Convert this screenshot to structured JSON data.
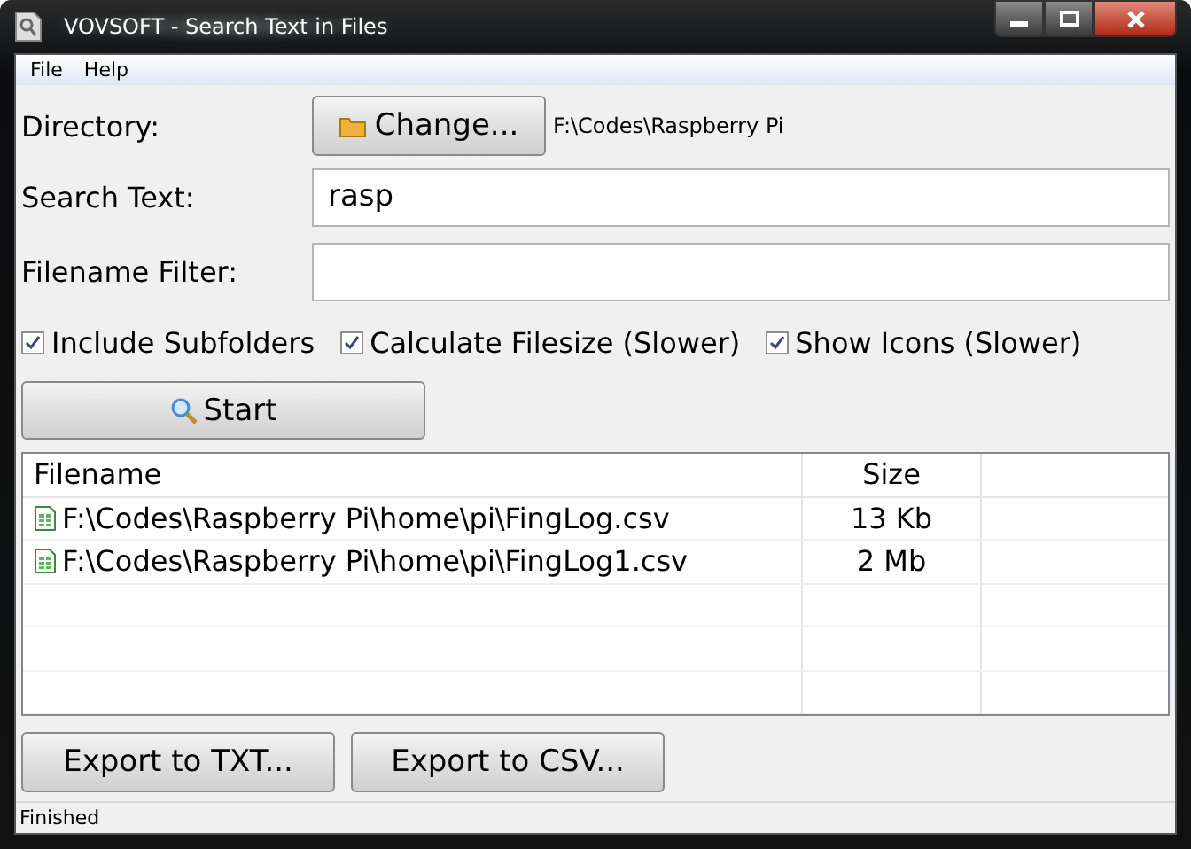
{
  "window": {
    "title": "VOVSOFT - Search Text in Files"
  },
  "menu": [
    "File",
    "Help"
  ],
  "directory": {
    "label": "Directory:",
    "button": "Change...",
    "path": "F:\\Codes\\Raspberry Pi"
  },
  "search_text": {
    "label": "Search Text:",
    "value": "rasp"
  },
  "filename_filter": {
    "label": "Filename Filter:"
  },
  "options": [
    {
      "label": "Include Subfolders",
      "checked": true
    },
    {
      "label": "Calculate Filesize (Slower)",
      "checked": true
    },
    {
      "label": "Show Icons (Slower)",
      "checked": true
    }
  ],
  "start_button": "Start",
  "table": {
    "columns": [
      "Filename",
      "Size"
    ],
    "rows": [
      {
        "filename": "F:\\Codes\\Raspberry Pi\\home\\pi\\FingLog.csv",
        "size": "13 Kb"
      },
      {
        "filename": "F:\\Codes\\Raspberry Pi\\home\\pi\\FingLog1.csv",
        "size": "2 Mb"
      }
    ]
  },
  "buttons": [
    "Export to TXT...",
    "Export to CSV..."
  ],
  "status_bar": "Finished"
}
